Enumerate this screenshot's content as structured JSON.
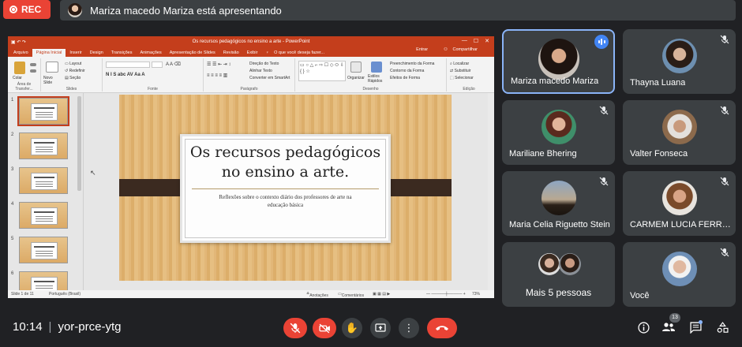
{
  "top": {
    "rec_label": "REC",
    "presenting_text": "Mariza macedo Mariza está apresentando"
  },
  "ppt": {
    "window_title": "Os recursos pedagógicos no ensino a arte - PowerPoint",
    "tabs": [
      "Arquivo",
      "Página Inicial",
      "Inserir",
      "Design",
      "Transições",
      "Animações",
      "Apresentação de Slides",
      "Revisão",
      "Exibir"
    ],
    "tell_me": "O que você deseja fazer...",
    "sign_in": "Entrar",
    "share": "Compartilhar",
    "ribbon": {
      "paste": "Colar",
      "new_slide": "Novo Slide",
      "layout": "Layout",
      "reset": "Redefinir",
      "section": "Seção",
      "group_clipboard": "Área de Transfer...",
      "group_slides": "Slides",
      "group_font": "Fonte",
      "group_paragraph": "Parágrafo",
      "group_drawing": "Desenho",
      "group_editing": "Edição",
      "text_direction": "Direção do Texto",
      "align_text": "Alinhar Texto",
      "smartart": "Converter em SmartArt",
      "arrange": "Organizar",
      "quick_styles": "Estilos Rápidos",
      "shape_fill": "Preenchimento da Forma",
      "shape_outline": "Contorno da Forma",
      "shape_effects": "Efeitos de Forma",
      "find": "Localizar",
      "replace": "Substituir",
      "select": "Selecionar"
    },
    "thumb_numbers": [
      "1",
      "2",
      "3",
      "4",
      "5",
      "6"
    ],
    "slide": {
      "title_line1": "Os recursos pedagógicos",
      "title_line2": "no ensino a arte.",
      "subtitle_line1": "Reflexões sobre o contexto diário dos professores de arte na",
      "subtitle_line2": "educação básica"
    },
    "status": {
      "slide_count": "Slide 1 de 11",
      "language": "Português (Brasil)",
      "notes": "Anotações",
      "comments": "Comentários",
      "zoom": "73%"
    }
  },
  "participants": [
    {
      "name": "Mariza macedo Mariza",
      "state": "speaking"
    },
    {
      "name": "Thayna Luana",
      "state": "muted"
    },
    {
      "name": "Mariliane Bhering",
      "state": "muted"
    },
    {
      "name": "Valter Fonseca",
      "state": "muted"
    },
    {
      "name": "Maria Celia Riguetto Stein",
      "state": "muted"
    },
    {
      "name": "CARMEM LUCIA FERREIRA",
      "state": "muted"
    },
    {
      "name": "Mais 5 pessoas",
      "state": "group"
    },
    {
      "name": "Você",
      "state": "muted"
    }
  ],
  "bottom": {
    "time": "10:14",
    "meeting_code": "yor-prce-ytg",
    "participant_count": "13"
  },
  "colors": {
    "background": "#202124",
    "tile": "#3c4043",
    "danger": "#ea4335",
    "accent": "#8ab4f8",
    "ppt_orange": "#c43e1c"
  }
}
